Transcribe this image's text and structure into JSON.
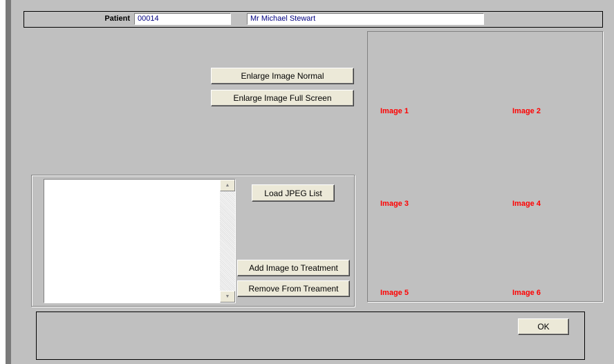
{
  "header": {
    "patient_label": "Patient",
    "patient_id": "00014",
    "patient_name": "Mr Michael Stewart"
  },
  "buttons": {
    "enlarge_normal": "Enlarge Image Normal",
    "enlarge_full": "Enlarge Image Full Screen",
    "load_jpeg": "Load JPEG List",
    "add_image": "Add Image to Treatment",
    "remove": "Remove From Treament",
    "ok": "OK"
  },
  "image_slots": [
    "Image 1",
    "Image 2",
    "Image 3",
    "Image 4",
    "Image 5",
    "Image 6"
  ],
  "colors": {
    "background": "#c0c0c0",
    "button_face": "#ece9d8",
    "image_label": "#ff0000",
    "field_text": "#000080"
  },
  "icons": {
    "scroll_up": "▲",
    "scroll_down": "▼"
  }
}
